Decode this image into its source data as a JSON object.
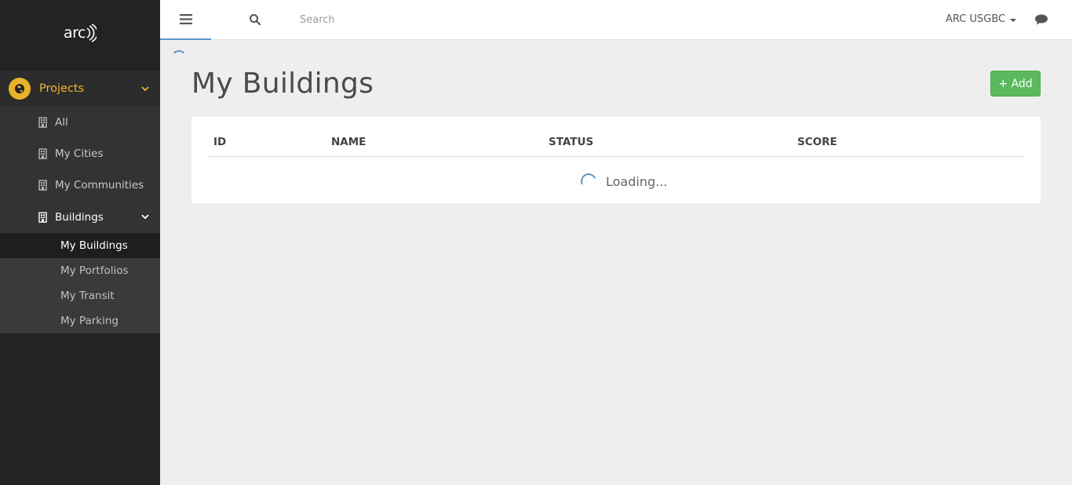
{
  "sidebar": {
    "logo": "arc",
    "projects_label": "Projects",
    "items": [
      {
        "label": "All",
        "icon": "building-icon"
      },
      {
        "label": "My Cities",
        "icon": "building-icon"
      },
      {
        "label": "My Communities",
        "icon": "building-icon"
      },
      {
        "label": "Buildings",
        "icon": "building-icon"
      }
    ],
    "sub_items": [
      {
        "label": "My Buildings"
      },
      {
        "label": "My Portfolios"
      },
      {
        "label": "My Transit"
      },
      {
        "label": "My Parking"
      }
    ]
  },
  "topbar": {
    "search_placeholder": "Search",
    "user_label": "ARC USGBC"
  },
  "main": {
    "title": "My Buildings",
    "add_label": "+ Add",
    "table": {
      "columns": [
        "ID",
        "NAME",
        "STATUS",
        "SCORE"
      ],
      "loading_text": "Loading..."
    }
  },
  "colors": {
    "accent": "#f0b72f",
    "success": "#5cb85c",
    "spinner": "#5b95c9",
    "sidebar_bg": "#232323"
  }
}
